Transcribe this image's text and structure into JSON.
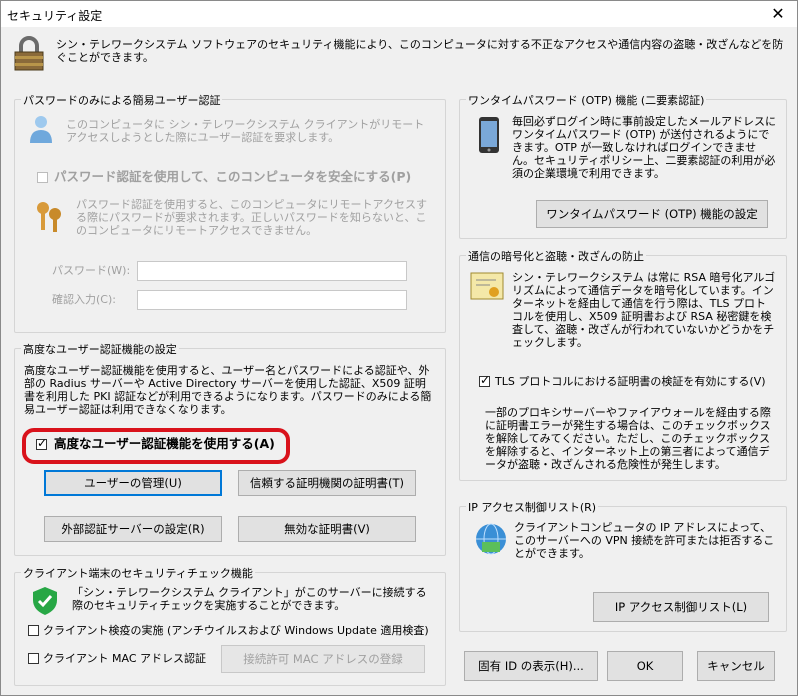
{
  "window": {
    "title": "セキュリティ設定",
    "close_glyph": "✕"
  },
  "header": {
    "text": "シン・テレワークシステム ソフトウェアのセキュリティ機能により、このコンピュータに対する不正なアクセスや通信内容の盗聴・改ざんなどを防ぐことができます。"
  },
  "password_group": {
    "title": "パスワードのみによる簡易ユーザー認証",
    "desc": "このコンピュータに シン・テレワークシステム クライアントがリモートアクセスしようとした際にユーザー認証を要求します。",
    "checkbox_label": "パスワード認証を使用して、このコンピュータを安全にする(P)",
    "desc2": "パスワード認証を使用すると、このコンピュータにリモートアクセスする際にパスワードが要求されます。正しいパスワードを知らないと、このコンピュータにリモートアクセスできません。",
    "password_label": "パスワード(W):",
    "confirm_label": "確認入力(C):",
    "password_value": "",
    "confirm_value": ""
  },
  "advanced_group": {
    "title": "高度なユーザー認証機能の設定",
    "desc": "高度なユーザー認証機能を使用すると、ユーザー名とパスワードによる認証や、外部の Radius サーバーや Active Directory サーバーを使用した認証、X509 証明書を利用した PKI 認証などが利用できるようになります。パスワードのみによる簡易ユーザー認証は利用できなくなります。",
    "checkbox_label": "高度なユーザー認証機能を使用する(A)",
    "checked": true,
    "btn_user_mgmt": "ユーザーの管理(U)",
    "btn_trusted_ca": "信頼する証明機関の証明書(T)",
    "btn_ext_server": "外部認証サーバーの設定(R)",
    "btn_invalid_cert": "無効な証明書(V)"
  },
  "client_group": {
    "title": "クライアント端末のセキュリティチェック機能",
    "desc": "「シン・テレワークシステム クライアント」がこのサーバーに接続する際のセキュリティチェックを実施することができます。",
    "cb_quarantine": "クライアント検疫の実施 (アンチウイルスおよび Windows Update 適用検査)",
    "cb_mac": "クライアント MAC アドレス認証",
    "btn_mac_register": "接続許可 MAC アドレスの登録"
  },
  "otp_group": {
    "title": "ワンタイムパスワード (OTP) 機能 (二要素認証)",
    "desc": "毎回必ずログイン時に事前設定したメールアドレスにワンタイムパスワード (OTP) が送付されるようにできます。OTP が一致しなければログインできません。セキュリティポリシー上、二要素認証の利用が必須の企業環境で利用できます。",
    "button": "ワンタイムパスワード (OTP) 機能の設定"
  },
  "crypto_group": {
    "title": "通信の暗号化と盗聴・改ざんの防止",
    "desc": "シン・テレワークシステム は常に RSA 暗号化アルゴリズムによって通信データを暗号化しています。インターネットを経由して通信を行う際は、TLS プロトコルを使用し、X509 証明書および RSA 秘密鍵を検査して、盗聴・改ざんが行われていないかどうかをチェックします。",
    "checkbox_label": "TLS プロトコルにおける証明書の検証を有効にする(V)",
    "checked": true,
    "desc2": "一部のプロキシサーバーやファイアウォールを経由する際に証明書エラーが発生する場合は、このチェックボックスを解除してみてください。ただし、このチェックボックスを解除すると、インターネット上の第三者によって通信データが盗聴・改ざんされる危険性が発生します。"
  },
  "ip_group": {
    "title": "IP アクセス制御リスト(R)",
    "desc": "クライアントコンピュータの IP アドレスによって、このサーバーへの VPN 接続を許可または拒否することができます。",
    "button": "IP アクセス制御リスト(L)"
  },
  "footer": {
    "btn_id": "固有 ID の表示(H)...",
    "btn_ok": "OK",
    "btn_cancel": "キャンセル"
  },
  "colors": {
    "highlight": "#d9121b",
    "focus": "#0078d7",
    "bg": "#f0f0f0"
  }
}
